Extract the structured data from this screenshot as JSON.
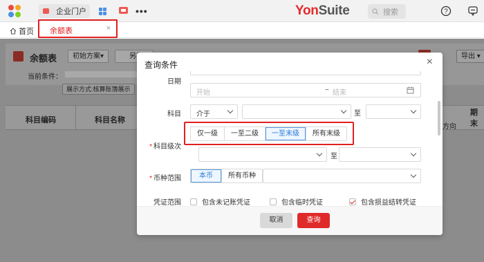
{
  "topbar": {
    "app_tab_label": "企业门户",
    "brand_yon": "Yon",
    "brand_suite": "Suite",
    "search_placeholder": "搜索",
    "more_label": "•••"
  },
  "tabs": {
    "home_label": "首页",
    "active_label": "余额表",
    "close_glyph": "×"
  },
  "page": {
    "title": "余额表",
    "plan_button": "初始方案▾",
    "save_as_button": "另存",
    "condition_label": "当前条件：",
    "display_mode": "展示方式:核算账簿展示",
    "export_button": "导出 ▾",
    "columns": [
      "科目编码",
      "科目名称"
    ],
    "end_balance": "期末",
    "direction": "方向"
  },
  "modal": {
    "title": "查询条件",
    "close_glyph": "×",
    "date": {
      "label": "日期",
      "start_placeholder": "开始",
      "separator": "~",
      "end_placeholder": "结束"
    },
    "account": {
      "label": "科目",
      "operator": "介于",
      "to": "至"
    },
    "account_level": {
      "label": "科目级次",
      "options": [
        "仅一级",
        "一至二级",
        "一至末级",
        "所有末级"
      ],
      "selected": "一至末级",
      "to": "至"
    },
    "currency": {
      "label": "币种范围",
      "options": [
        "本币",
        "所有币种"
      ],
      "selected": "本币"
    },
    "voucher": {
      "label": "凭证范围",
      "options": [
        {
          "label": "包含未记账凭证",
          "checked": false
        },
        {
          "label": "包含临时凭证",
          "checked": false
        },
        {
          "label": "包含损益结转凭证",
          "checked": true
        }
      ]
    },
    "cancel_button": "取消",
    "query_button": "查询"
  },
  "colors": {
    "accent_red": "#e02020",
    "selected_blue": "#2b7bd6"
  }
}
